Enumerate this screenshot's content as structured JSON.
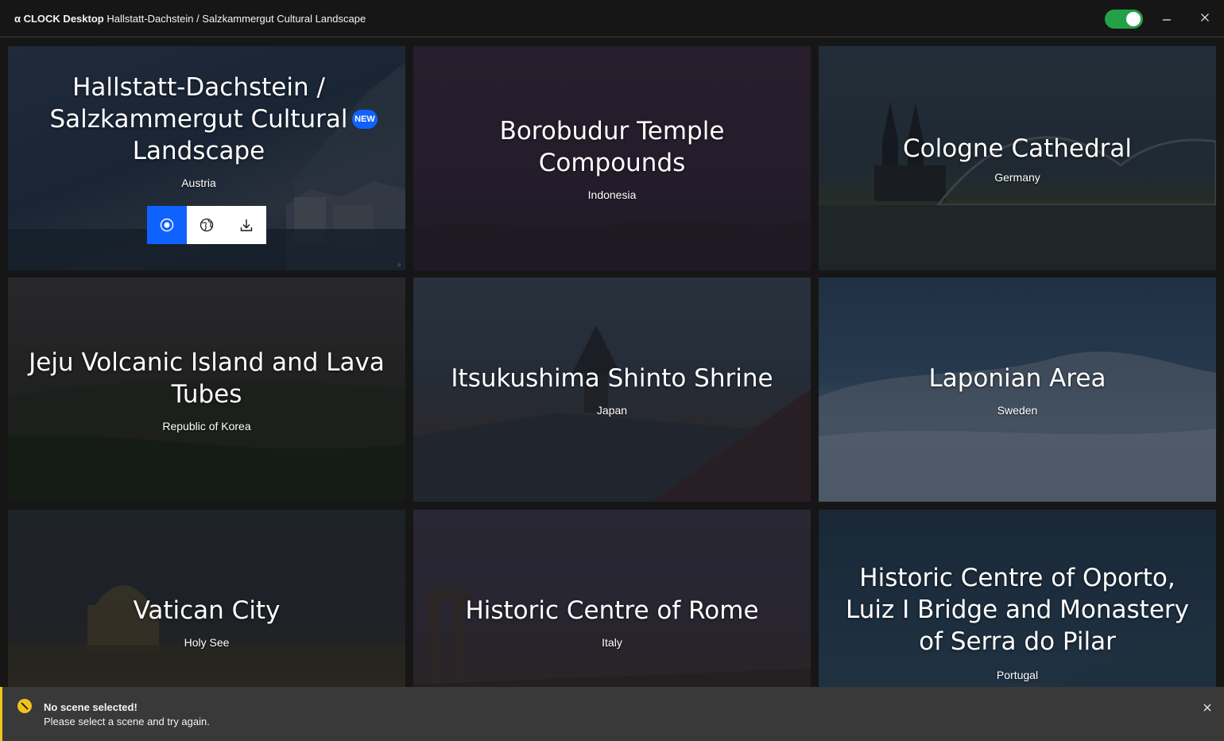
{
  "window": {
    "brand": "α CLOCK Desktop",
    "subtitle": "Hallstatt-Dachstein / Salzkammergut Cultural Landscape",
    "toggle_on": true
  },
  "colors": {
    "accent": "#0f62fe",
    "toggle": "#24a148",
    "warning": "#f1c21b",
    "toast_bg": "#393939"
  },
  "tiles": [
    {
      "name": "Hallstatt-Dachstein / Salzkammergut Cultural Landscape",
      "country": "Austria",
      "badge": "NEW",
      "selected": true
    },
    {
      "name": "Borobudur Temple Compounds",
      "country": "Indonesia"
    },
    {
      "name": "Cologne Cathedral",
      "country": "Germany"
    },
    {
      "name": "Jeju Volcanic Island and Lava Tubes",
      "country": "Republic of Korea"
    },
    {
      "name": "Itsukushima Shinto Shrine",
      "country": "Japan"
    },
    {
      "name": "Laponian Area",
      "country": "Sweden"
    },
    {
      "name": "Vatican City",
      "country": "Holy See"
    },
    {
      "name": "Historic Centre of Rome",
      "country": "Italy"
    },
    {
      "name": "Historic Centre of Oporto, Luiz I Bridge and Monastery of Serra do Pilar",
      "country": "Portugal"
    }
  ],
  "tile_actions": [
    {
      "icon": "record-icon"
    },
    {
      "icon": "globe-icon"
    },
    {
      "icon": "download-icon"
    }
  ],
  "toast": {
    "icon": "warning-icon",
    "title": "No scene selected!",
    "message": "Please select a scene and try again."
  }
}
